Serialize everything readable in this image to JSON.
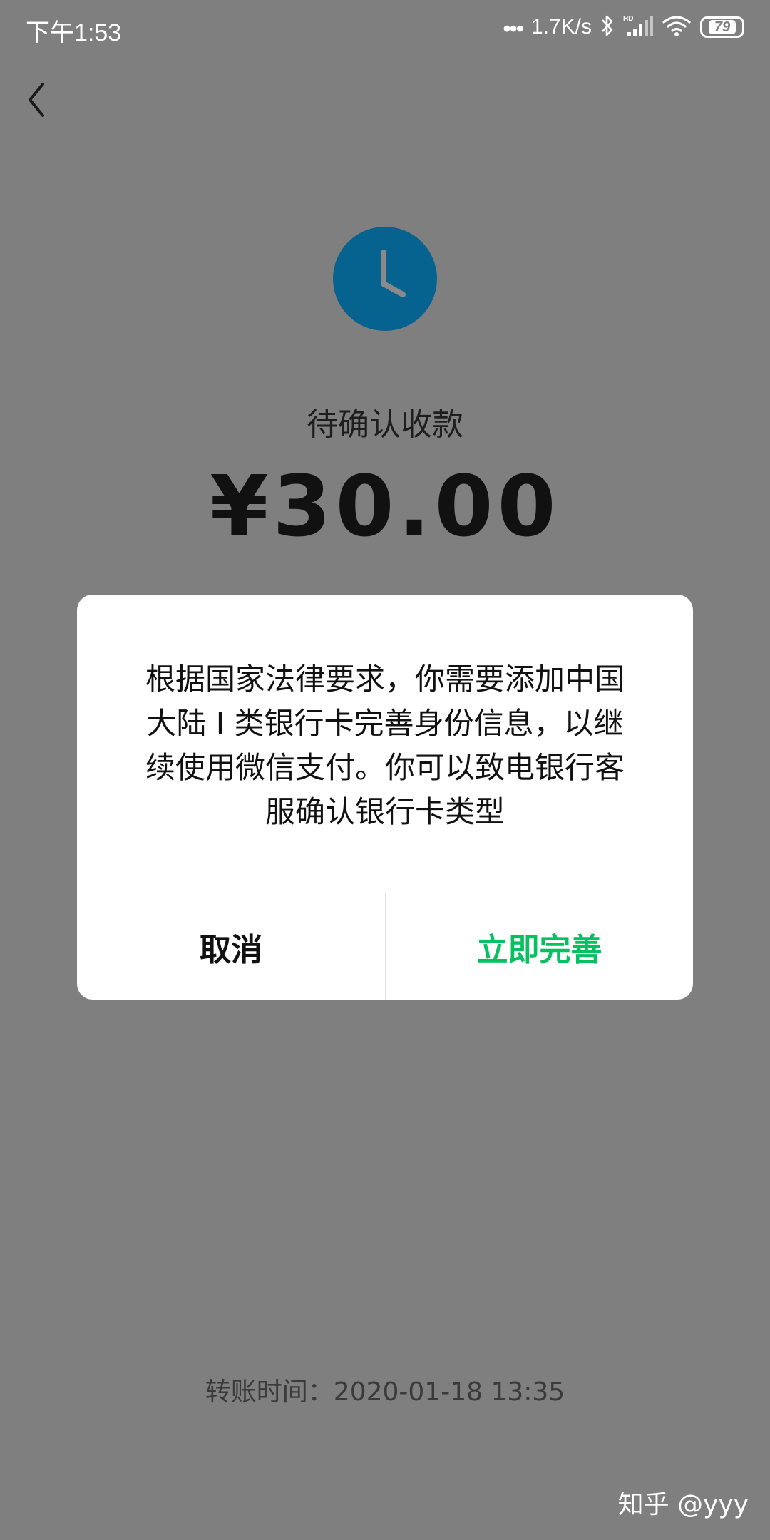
{
  "status_bar": {
    "time": "下午1:53",
    "dots": "•••",
    "network_speed": "1.7K/s",
    "battery": "79",
    "icons": [
      "bluetooth-icon",
      "hd-signal-icon",
      "wifi-icon",
      "battery-icon"
    ]
  },
  "page": {
    "status_title": "待确认收款",
    "amount": "¥30.00",
    "transfer_time": "转账时间：2020-01-18 13:35",
    "watermark": "知乎 @yyy",
    "icon_color": "#06628f"
  },
  "dialog": {
    "message_lines": [
      "根据国家法律要求，你需要添加中国",
      "大陆 I 类银行卡完善身份信息，以继",
      "续使用微信支付。你可以致电银行客",
      "服确认银行卡类型"
    ],
    "cancel_label": "取消",
    "confirm_label": "立即完善",
    "confirm_color": "#07c160"
  }
}
